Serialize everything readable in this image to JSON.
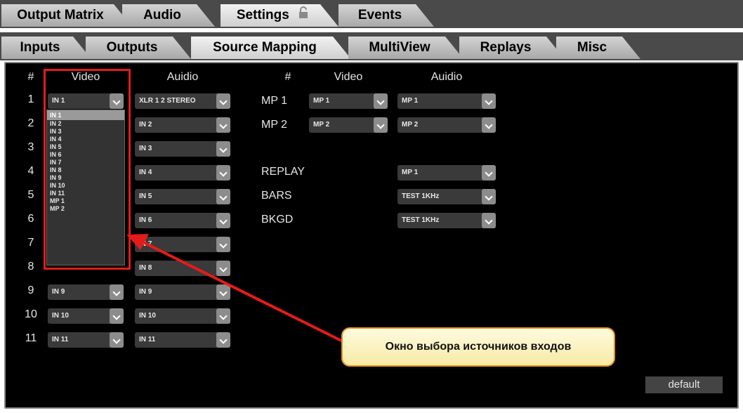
{
  "main_tabs": [
    "Output Matrix",
    "Audio",
    "Settings",
    "Events"
  ],
  "sub_tabs": [
    "Inputs",
    "Outputs",
    "Source Mapping",
    "MultiView",
    "Replays",
    "Misc"
  ],
  "headers": {
    "num": "#",
    "video": "Video",
    "audio": "Auidio",
    "num2": "#",
    "video2": "Video",
    "audio2": "Auidio"
  },
  "rows": [
    {
      "num": "1",
      "video": "IN 1",
      "audio": "XLR 1 2 STEREO"
    },
    {
      "num": "2",
      "audio": "IN 2"
    },
    {
      "num": "3",
      "audio": "IN 3"
    },
    {
      "num": "4",
      "audio": "IN 4"
    },
    {
      "num": "5",
      "audio": "IN 5"
    },
    {
      "num": "6",
      "audio": "IN 6"
    },
    {
      "num": "7",
      "audio": "IN 7"
    },
    {
      "num": "8",
      "audio": "IN 8"
    },
    {
      "num": "9",
      "video": "IN 9",
      "audio": "IN 9"
    },
    {
      "num": "10",
      "video": "IN 10",
      "audio": "IN 10"
    },
    {
      "num": "11",
      "video": "IN 11",
      "audio": "IN 11"
    }
  ],
  "dropdown_options": [
    "IN 1",
    "IN 2",
    "IN 3",
    "IN 4",
    "IN 5",
    "IN 6",
    "IN 7",
    "IN 8",
    "IN 9",
    "IN 10",
    "IN 11",
    "MP 1",
    "MP 2"
  ],
  "mp_rows": [
    {
      "label": "MP 1",
      "video": "MP 1",
      "audio": "MP 1"
    },
    {
      "label": "MP 2",
      "video": "MP 2",
      "audio": "MP 2"
    },
    {
      "label": "REPLAY",
      "audio": "MP 1"
    },
    {
      "label": "BARS",
      "audio": "TEST 1KHz"
    },
    {
      "label": "BKGD",
      "audio": "TEST 1KHz"
    }
  ],
  "callout": "Окно выбора источников входов",
  "default_label": "default"
}
